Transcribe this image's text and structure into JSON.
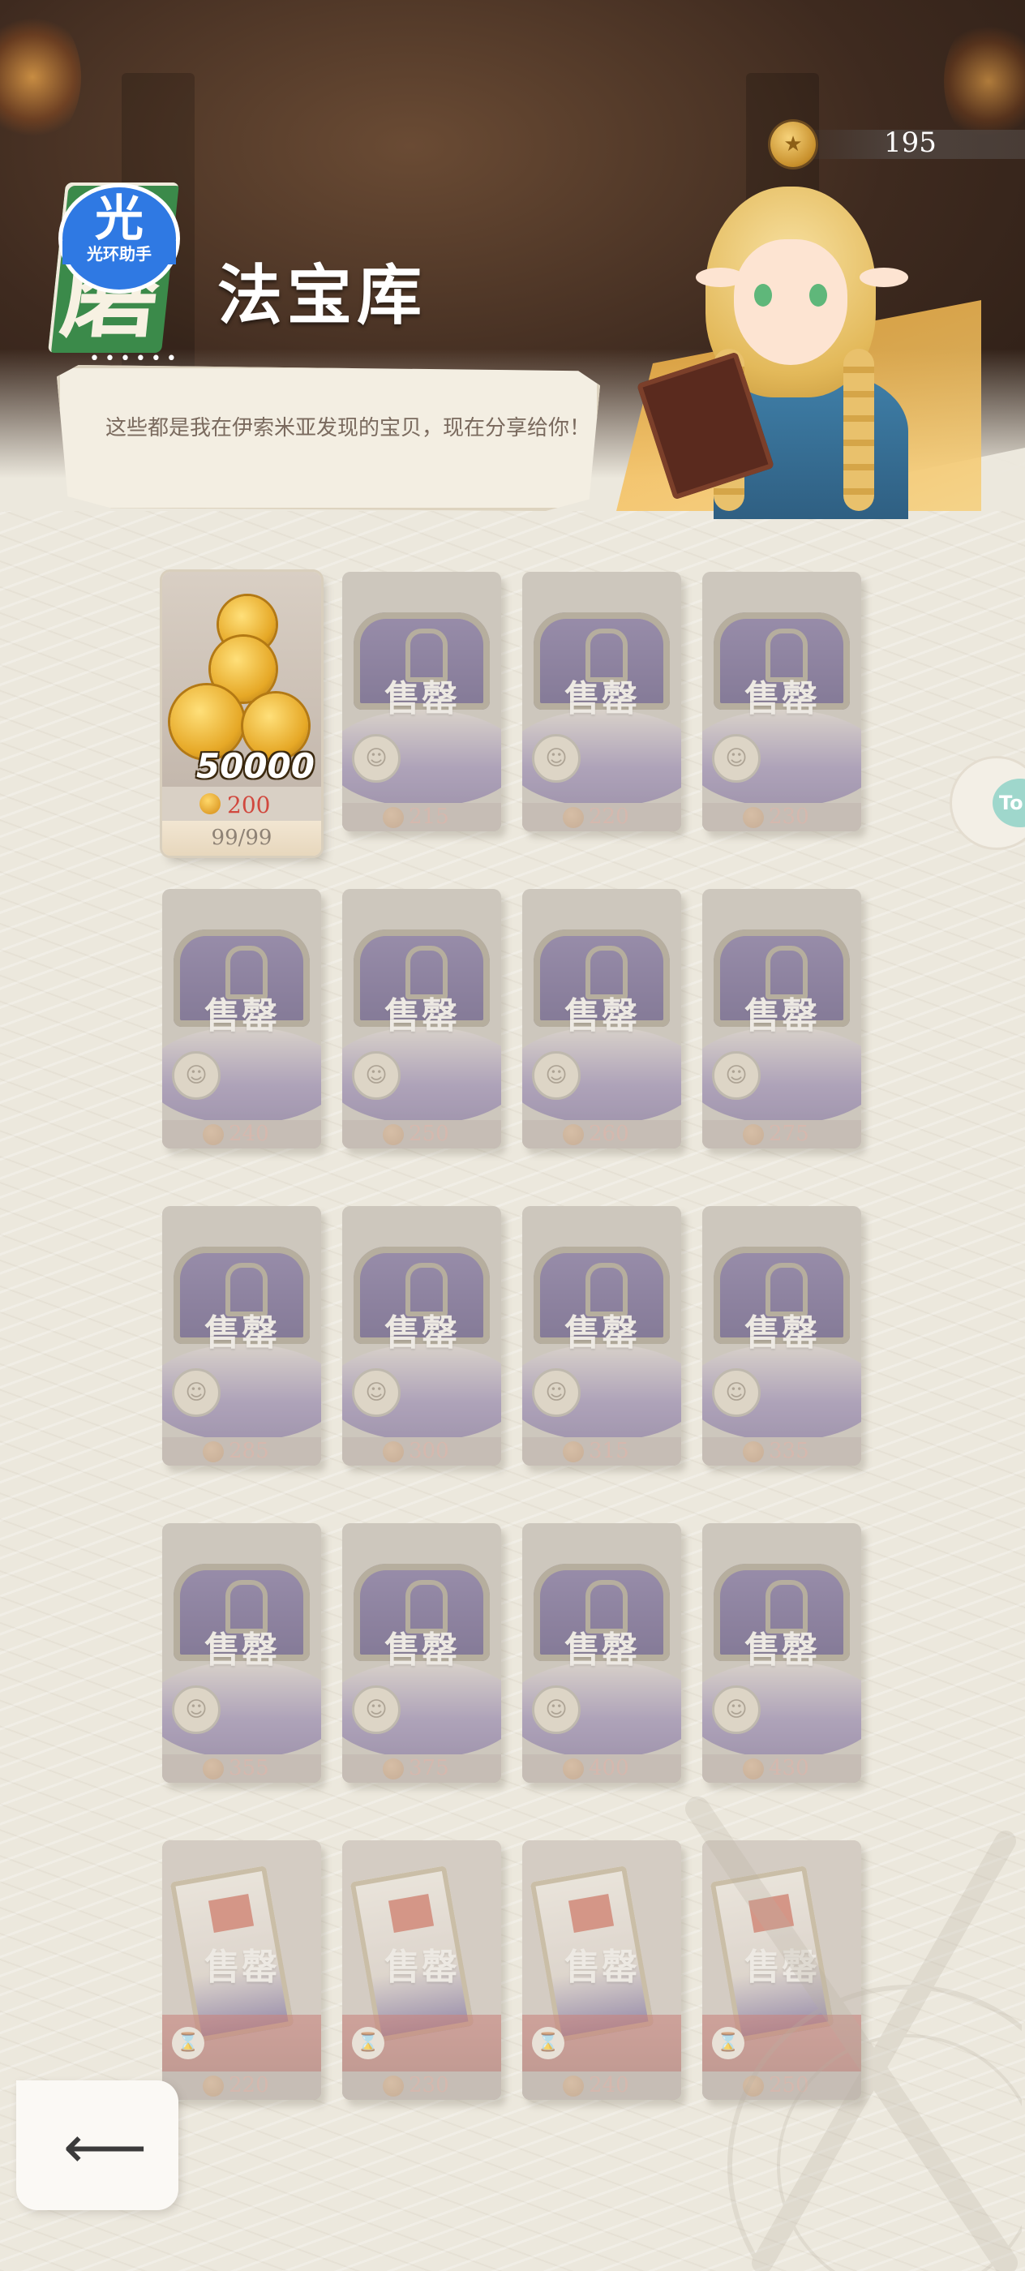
{
  "header": {
    "title": "法宝库",
    "badge_big": "光",
    "badge_small": "光环助手",
    "logo_glyph": "磨",
    "dots": "••••••",
    "speech": "这些都是我在伊索米亚发现的宝贝，现在分享给你！"
  },
  "currency": {
    "amount": "195",
    "icon": "coin-icon"
  },
  "side_tab": {
    "label": "To"
  },
  "sold_label": "售罄",
  "featured": {
    "amount": "50000",
    "price": "200",
    "stock": "99/99"
  },
  "cards": [
    {
      "price": "215",
      "type": "chest"
    },
    {
      "price": "220",
      "type": "chest"
    },
    {
      "price": "230",
      "type": "chest"
    },
    {
      "price": "240",
      "type": "chest"
    },
    {
      "price": "250",
      "type": "chest"
    },
    {
      "price": "260",
      "type": "chest"
    },
    {
      "price": "275",
      "type": "chest"
    },
    {
      "price": "285",
      "type": "chest"
    },
    {
      "price": "300",
      "type": "chest"
    },
    {
      "price": "315",
      "type": "chest"
    },
    {
      "price": "335",
      "type": "chest"
    },
    {
      "price": "355",
      "type": "chest"
    },
    {
      "price": "375",
      "type": "chest"
    },
    {
      "price": "400",
      "type": "chest"
    },
    {
      "price": "430",
      "type": "chest"
    },
    {
      "price": "220",
      "type": "banner"
    },
    {
      "price": "230",
      "type": "banner"
    },
    {
      "price": "240",
      "type": "banner"
    },
    {
      "price": "250",
      "type": "banner"
    }
  ],
  "back_button": {
    "icon": "back-arrow-icon",
    "glyph": "⟵"
  }
}
